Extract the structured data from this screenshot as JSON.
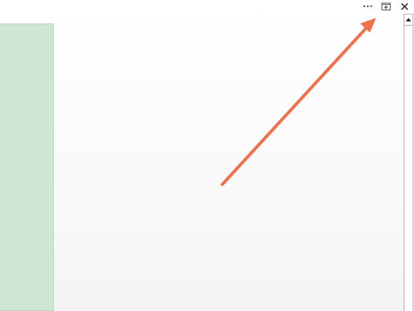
{
  "window_controls": {
    "more_icon": "more-dots-icon",
    "restore_icon": "ribbon-display-options-icon",
    "close_icon": "close-icon"
  },
  "annotation": {
    "color": "#f0704a",
    "points_to": "ribbon-display-options-button"
  },
  "colors": {
    "side_panel": "#cde7d3",
    "background": "#fafafa"
  }
}
